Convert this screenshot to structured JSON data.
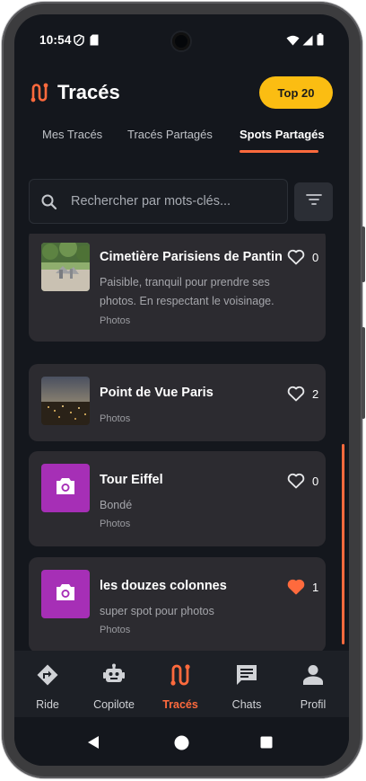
{
  "status_bar": {
    "time": "10:54"
  },
  "header": {
    "title": "Tracés",
    "top_button": "Top 20"
  },
  "tabs": [
    "Mes Tracés",
    "Tracés Partagés",
    "Spots Partagés"
  ],
  "search": {
    "placeholder": "Rechercher par mots-clés..."
  },
  "spots": [
    {
      "name": "Cimetière Parisiens de Pantin",
      "description": "Paisible, tranquil pour prendre ses photos. En respectant le voisinage.",
      "category": "Photos",
      "likes": "0",
      "liked": false,
      "thumb": "photo-cemetery"
    },
    {
      "name": "Point de Vue Paris",
      "description": "",
      "category": "Photos",
      "likes": "2",
      "liked": false,
      "thumb": "photo-paris-night"
    },
    {
      "name": "Tour Eiffel",
      "description": "Bondé",
      "category": "Photos",
      "likes": "0",
      "liked": false,
      "thumb": "camera-icon"
    },
    {
      "name": "les douzes colonnes",
      "description": "super spot pour photos",
      "category": "Photos",
      "likes": "1",
      "liked": true,
      "thumb": "camera-icon"
    }
  ],
  "bottom_nav": [
    {
      "label": "Ride",
      "icon": "directions-icon",
      "active": false
    },
    {
      "label": "Copilote",
      "icon": "robot-icon",
      "active": false
    },
    {
      "label": "Tracés",
      "icon": "route-icon",
      "active": true
    },
    {
      "label": "Chats",
      "icon": "chat-icon",
      "active": false
    },
    {
      "label": "Profil",
      "icon": "person-icon",
      "active": false
    }
  ],
  "colors": {
    "accent": "#ff6a3d",
    "top_button": "#fbbd12",
    "card": "#2c2b30",
    "background": "#14171d",
    "liked_heart": "#ff6a3d",
    "photo_thumb": "#a62fb6"
  }
}
